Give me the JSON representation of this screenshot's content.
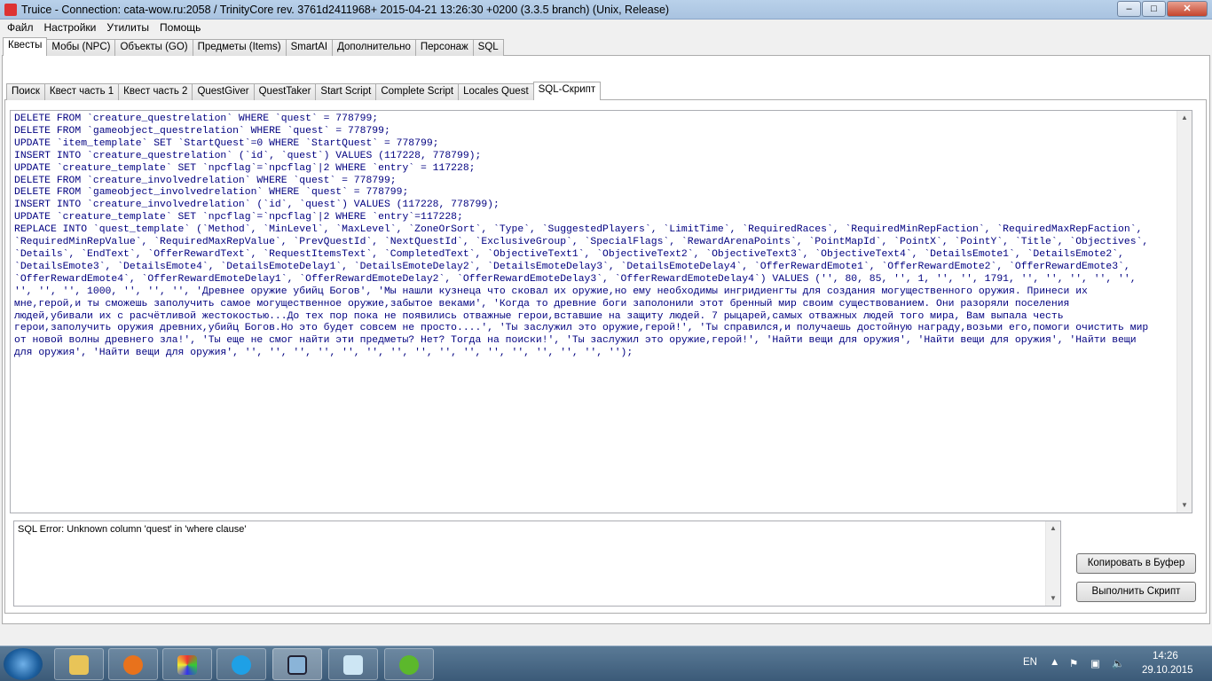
{
  "window": {
    "title": "Truice - Connection: cata-wow.ru:2058 / TrinityCore rev. 3761d2411968+ 2015-04-21 13:26:30 +0200 (3.3.5 branch) (Unix, Release)",
    "minimize": "‒",
    "maximize": "□",
    "close": "✕"
  },
  "menu": [
    "Файл",
    "Настройки",
    "Утилиты",
    "Помощь"
  ],
  "main_tabs": [
    "Квесты",
    "Мобы (NPC)",
    "Объекты (GO)",
    "Предметы (Items)",
    "SmartAI",
    "Дополнительно",
    "Персонаж",
    "SQL"
  ],
  "sub_tabs": [
    "Поиск",
    "Квест часть 1",
    "Квест часть 2",
    "QuestGiver",
    "QuestTaker",
    "Start Script",
    "Complete Script",
    "Locales Quest",
    "SQL-Скрипт"
  ],
  "sql_lines": [
    "DELETE FROM `creature_questrelation` WHERE `quest` = 778799;",
    "DELETE FROM `gameobject_questrelation` WHERE `quest` = 778799;",
    "UPDATE `item_template` SET `StartQuest`=0 WHERE `StartQuest` = 778799;",
    "INSERT INTO `creature_questrelation` (`id`, `quest`) VALUES (117228, 778799);",
    "UPDATE `creature_template` SET `npcflag`=`npcflag`|2 WHERE `entry` = 117228;",
    "DELETE FROM `creature_involvedrelation` WHERE `quest` = 778799;",
    "DELETE FROM `gameobject_involvedrelation` WHERE `quest` = 778799;",
    "INSERT INTO `creature_involvedrelation` (`id`, `quest`) VALUES (117228, 778799);",
    "UPDATE `creature_template` SET `npcflag`=`npcflag`|2 WHERE `entry`=117228;",
    "REPLACE INTO `quest_template` (`Method`, `MinLevel`, `MaxLevel`, `ZoneOrSort`, `Type`, `SuggestedPlayers`, `LimitTime`, `RequiredRaces`, `RequiredMinRepFaction`, `RequiredMaxRepFaction`,",
    "`RequiredMinRepValue`, `RequiredMaxRepValue`, `PrevQuestId`, `NextQuestId`, `ExclusiveGroup`, `SpecialFlags`, `RewardArenaPoints`, `PointMapId`, `PointX`, `PointY`, `Title`, `Objectives`,",
    "`Details`, `EndText`, `OfferRewardText`, `RequestItemsText`, `CompletedText`, `ObjectiveText1`, `ObjectiveText2`, `ObjectiveText3`, `ObjectiveText4`, `DetailsEmote1`, `DetailsEmote2`,",
    "`DetailsEmote3`, `DetailsEmote4`, `DetailsEmoteDelay1`, `DetailsEmoteDelay2`, `DetailsEmoteDelay3`, `DetailsEmoteDelay4`, `OfferRewardEmote1`, `OfferRewardEmote2`, `OfferRewardEmote3`,",
    "`OfferRewardEmote4`, `OfferRewardEmoteDelay1`, `OfferRewardEmoteDelay2`, `OfferRewardEmoteDelay3`, `OfferRewardEmoteDelay4`) VALUES ('', 80, 85, '', 1, '', '', 1791, '', '', '', '', '',",
    "'', '', '', 1000, '', '', '', 'Древнее оружие убийц Богов', 'Мы нашли кузнеца что сковал их оружие,но ему необходимы ингридиенгты для создания могущественного оружия. Принеси их",
    "мне,герой,и ты сможешь заполучить самое могущественное оружие,забытое веками', 'Когда то древние боги заполонили этот бренный мир своим существованием. Они разоряли поселения",
    "людей,убивали их с расчётливой жестокостью...До тех пор пока не появились отважные герои,вставшие на защиту людей. 7 рыцарей,самых отважных людей того мира, Вам выпала честь",
    "герои,заполучить оружия древних,убийц Богов.Но это будет совсем не просто....', 'Ты заслужил это оружие,герой!', 'Ты справился,и получаешь достойную награду,возьми его,помоги очистить мир",
    "от новой волны древнего зла!', 'Ты еще не смог найти эти предметы? Нет? Тогда на поиски!', 'Ты заслужил это оружие,герой!', 'Найти вещи для оружия', 'Найти вещи для оружия', 'Найти вещи",
    "для оружия', 'Найти вещи для оружия', '', '', '', '', '', '', '', '', '', '', '', '', '', '', '', '');"
  ],
  "error_text": "SQL Error: Unknown column 'quest' in 'where clause'",
  "buttons": {
    "copy": "Копировать в Буфер",
    "execute": "Выполнить Скрипт"
  },
  "tray": {
    "lang": "EN",
    "time": "14:26",
    "date": "29.10.2015"
  }
}
